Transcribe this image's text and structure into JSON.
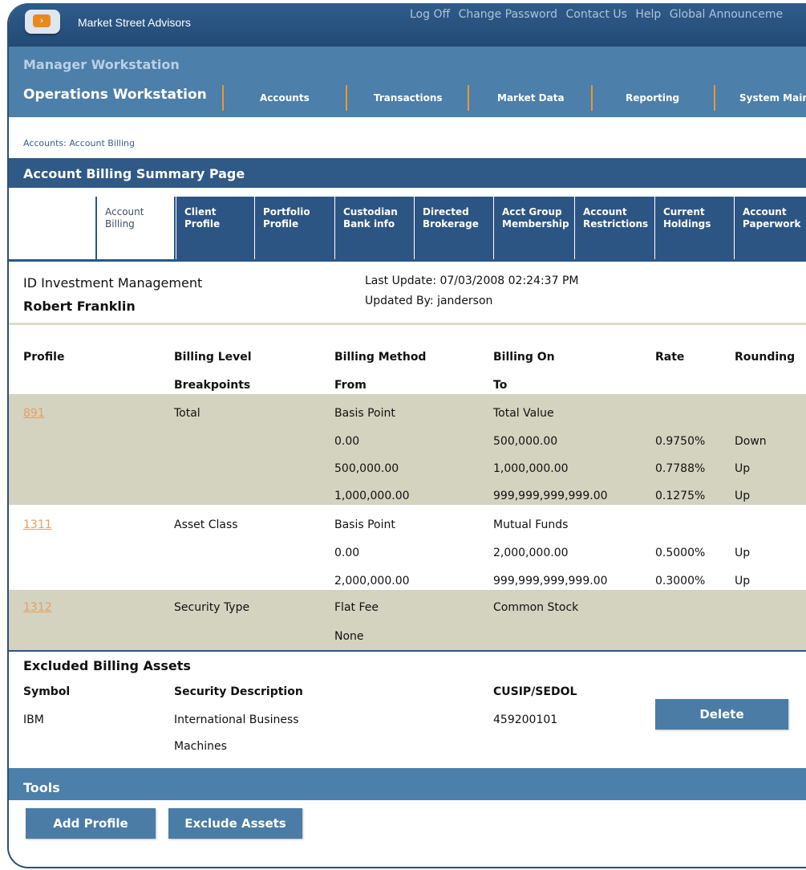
{
  "header": {
    "brand": "Market Street Advisors",
    "links": [
      "Log Off",
      "Change Password",
      "Contact Us",
      "Help",
      "Global Announceme"
    ]
  },
  "nav": {
    "manager": "Manager Workstation",
    "operations": "Operations Workstation",
    "items": [
      "Accounts",
      "Transactions",
      "Market Data",
      "Reporting",
      "System Maint"
    ]
  },
  "breadcrumb": "Accounts: Account Billing",
  "page_title": "Account Billing Summary Page",
  "tabs": [
    {
      "l1": "Account",
      "l2": "Billing"
    },
    {
      "l1": "Client",
      "l2": "Profile"
    },
    {
      "l1": "Portfolio",
      "l2": "Profile"
    },
    {
      "l1": "Custodian",
      "l2": "Bank info"
    },
    {
      "l1": "Directed",
      "l2": "Brokerage"
    },
    {
      "l1": "Acct Group",
      "l2": "Membership"
    },
    {
      "l1": "Account",
      "l2": "Restrictions"
    },
    {
      "l1": "Current",
      "l2": "Holdings"
    },
    {
      "l1": "Account",
      "l2": "Paperwork"
    }
  ],
  "account": {
    "firm": "ID Investment Management",
    "person": "Robert Franklin",
    "last_update": "Last Update: 07/03/2008 02:24:37 PM",
    "updated_by": "Updated By: janderson"
  },
  "billing_table": {
    "headers": {
      "profile": "Profile",
      "level": "Billing Level",
      "method": "Billing Method",
      "on": "Billing On",
      "rate": "Rate",
      "rounding": "Rounding",
      "breakpoints": "Breakpoints",
      "from": "From",
      "to": "To"
    },
    "profiles": [
      {
        "id": "891",
        "level": "Total",
        "method": "Basis Point",
        "on": "Total Value",
        "rows": [
          {
            "from": "0.00",
            "to": "500,000.00",
            "rate": "0.9750%",
            "rounding": "Down"
          },
          {
            "from": "500,000.00",
            "to": "1,000,000.00",
            "rate": "0.7788%",
            "rounding": "Up"
          },
          {
            "from": "1,000,000.00",
            "to": "999,999,999,999.00",
            "rate": "0.1275%",
            "rounding": "Up"
          }
        ]
      },
      {
        "id": "1311",
        "level": "Asset Class",
        "method": "Basis Point",
        "on": "Mutual Funds",
        "rows": [
          {
            "from": "0.00",
            "to": "2,000,000.00",
            "rate": "0.5000%",
            "rounding": "Up"
          },
          {
            "from": "2,000,000.00",
            "to": "999,999,999,999.00",
            "rate": "0.3000%",
            "rounding": "Up"
          }
        ]
      },
      {
        "id": "1312",
        "level": "Security Type",
        "method": "Flat Fee",
        "on": "Common Stock",
        "extra": "None"
      }
    ]
  },
  "excluded": {
    "title": "Excluded Billing Assets",
    "headers": {
      "symbol": "Symbol",
      "description": "Security Description",
      "cusip": "CUSIP/SEDOL"
    },
    "row": {
      "symbol": "IBM",
      "desc1": "International Business",
      "desc2": "Machines",
      "cusip": "459200101"
    },
    "delete_label": "Delete"
  },
  "tools": {
    "title": "Tools",
    "add_profile": "Add Profile",
    "exclude_assets": "Exclude Assets"
  },
  "colors": {
    "header_dark": "#2f5986",
    "nav_blue": "#4c7fa9",
    "band": "#d3d3c0",
    "link_orange": "#e4a062",
    "separator_orange": "#e89a2e"
  }
}
